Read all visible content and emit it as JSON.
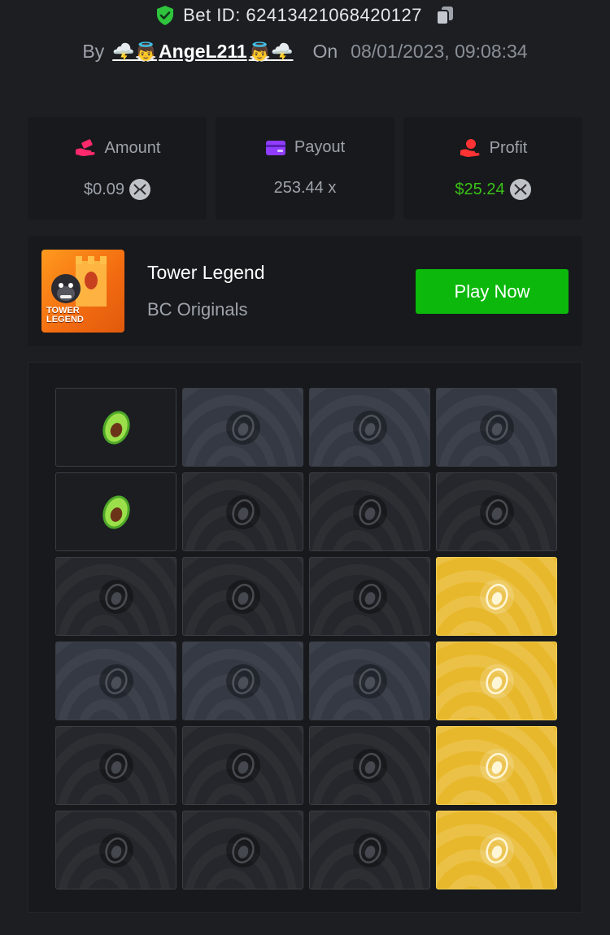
{
  "bet": {
    "label": "Bet ID: 62413421068420127",
    "by_label": "By",
    "username": "AngeL211",
    "user_emoji_left": "🌩️👼",
    "user_emoji_right": "👼🌩️",
    "on_label": "On",
    "timestamp": "08/01/2023, 09:08:34"
  },
  "stats": {
    "amount": {
      "label": "Amount",
      "value": "$0.09",
      "icon": "money-hand-icon",
      "color": "#ff2a6d"
    },
    "payout": {
      "label": "Payout",
      "value": "253.44 x",
      "icon": "wallet-card-icon",
      "color": "#8f3cff"
    },
    "profit": {
      "label": "Profit",
      "value": "$25.24",
      "icon": "hand-coins-icon",
      "color": "#ff3333",
      "value_color": "#3bc117"
    }
  },
  "game": {
    "thumb_title": "TOWER\nLEGEND",
    "name": "Tower Legend",
    "provider": "BC Originals",
    "play_label": "Play Now"
  },
  "board": {
    "columns": 4,
    "rows": [
      [
        "picked-avocado",
        "slate",
        "slate",
        "slate"
      ],
      [
        "picked-avocado",
        "dark",
        "dark",
        "dark"
      ],
      [
        "dark",
        "dark",
        "dark",
        "gold"
      ],
      [
        "slate",
        "slate",
        "slate",
        "gold"
      ],
      [
        "dark",
        "dark",
        "dark",
        "gold"
      ],
      [
        "dark",
        "dark",
        "dark",
        "gold"
      ]
    ]
  },
  "colors": {
    "background": "#1c1e22",
    "card": "#17191c",
    "accent_green": "#0bb80b",
    "gold": "#e8b82c"
  }
}
